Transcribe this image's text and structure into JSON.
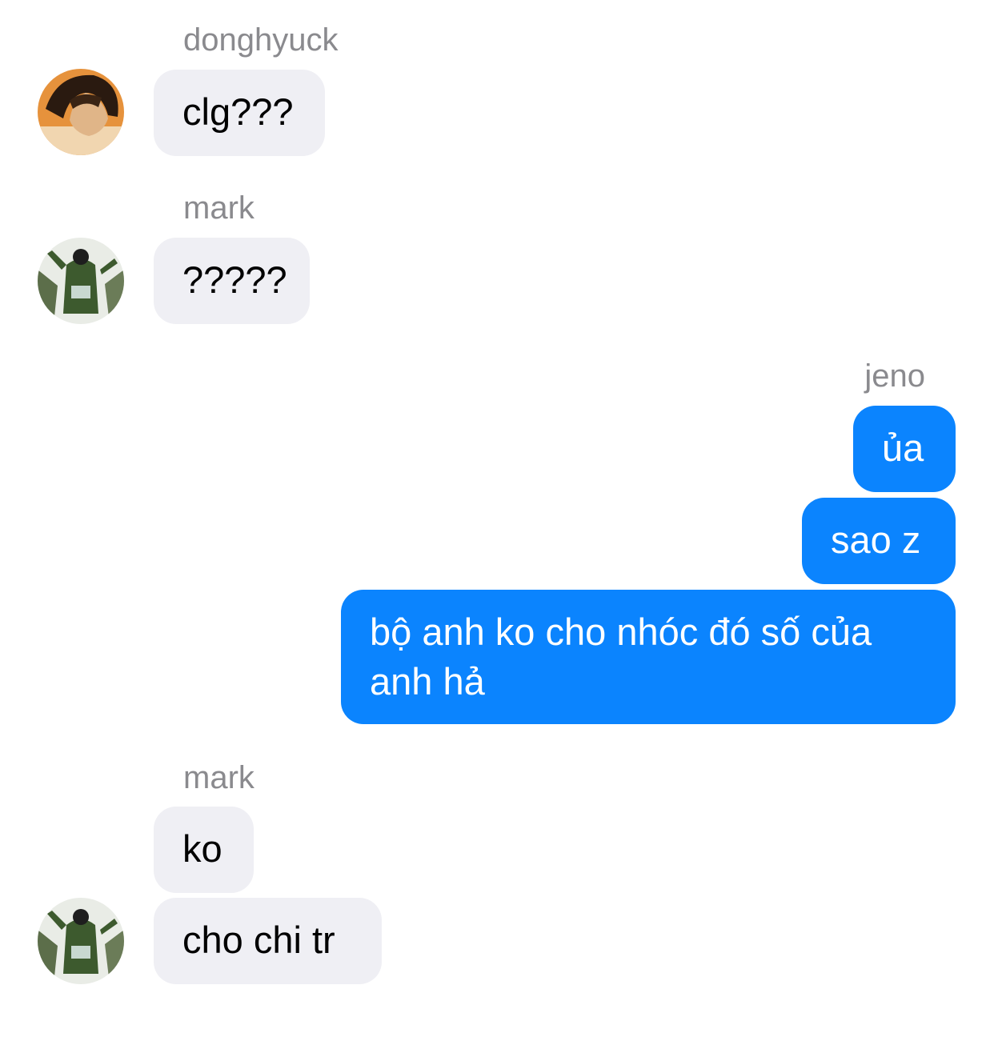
{
  "messages": [
    {
      "sender": "donghyuck",
      "text": "clg???"
    },
    {
      "sender": "mark",
      "text": "?????"
    },
    {
      "sender": "jeno",
      "texts": [
        "ủa",
        "sao z",
        "bộ anh ko cho nhóc đó số của",
        "anh hả"
      ]
    },
    {
      "sender": "mark",
      "texts": [
        "ko",
        "cho chi tr"
      ]
    }
  ],
  "colors": {
    "incoming_bubble": "#efeff4",
    "outgoing_bubble": "#0b84fe",
    "sender_label": "#8a8a8e"
  }
}
